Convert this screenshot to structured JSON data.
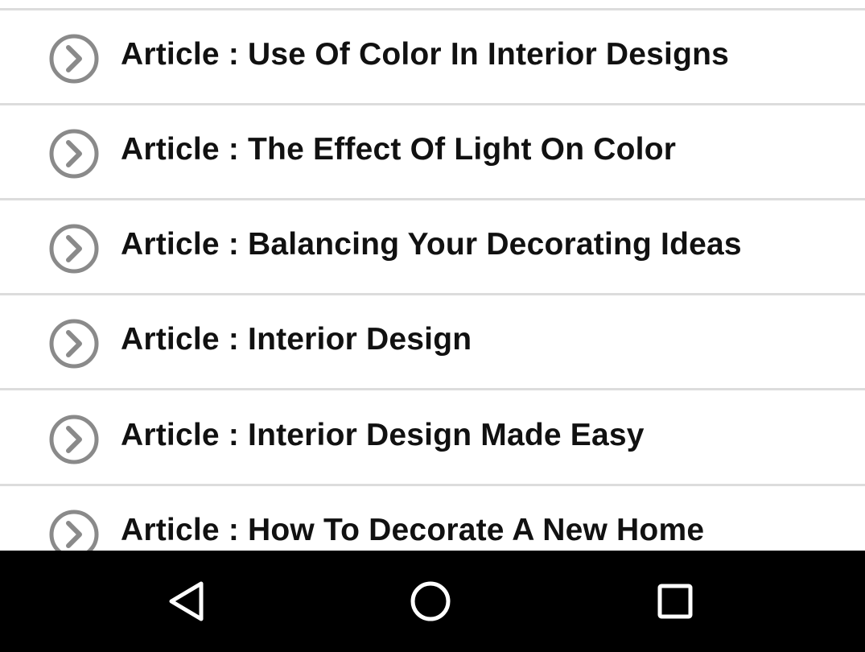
{
  "articles": [
    {
      "label": "Article : Use Of Color In Interior Designs",
      "icon": "chevron-right-circle-icon"
    },
    {
      "label": "Article : The Effect Of Light On Color",
      "icon": "chevron-right-circle-icon"
    },
    {
      "label": "Article : Balancing Your Decorating Ideas",
      "icon": "chevron-right-circle-icon"
    },
    {
      "label": "Article : Interior Design",
      "icon": "chevron-right-circle-icon"
    },
    {
      "label": "Article : Interior Design Made Easy",
      "icon": "chevron-right-circle-icon"
    },
    {
      "label": "Article : How To Decorate A New Home",
      "icon": "chevron-right-circle-icon"
    }
  ],
  "nav_bar": {
    "back_icon": "back-triangle-icon",
    "home_icon": "home-circle-icon",
    "recents_icon": "recents-square-icon"
  },
  "colors": {
    "background": "#ffffff",
    "divider": "#dcdcdc",
    "text": "#111111",
    "icon": "#8a8a8a",
    "nav_bar": "#000000",
    "nav_icon": "#ffffff"
  }
}
